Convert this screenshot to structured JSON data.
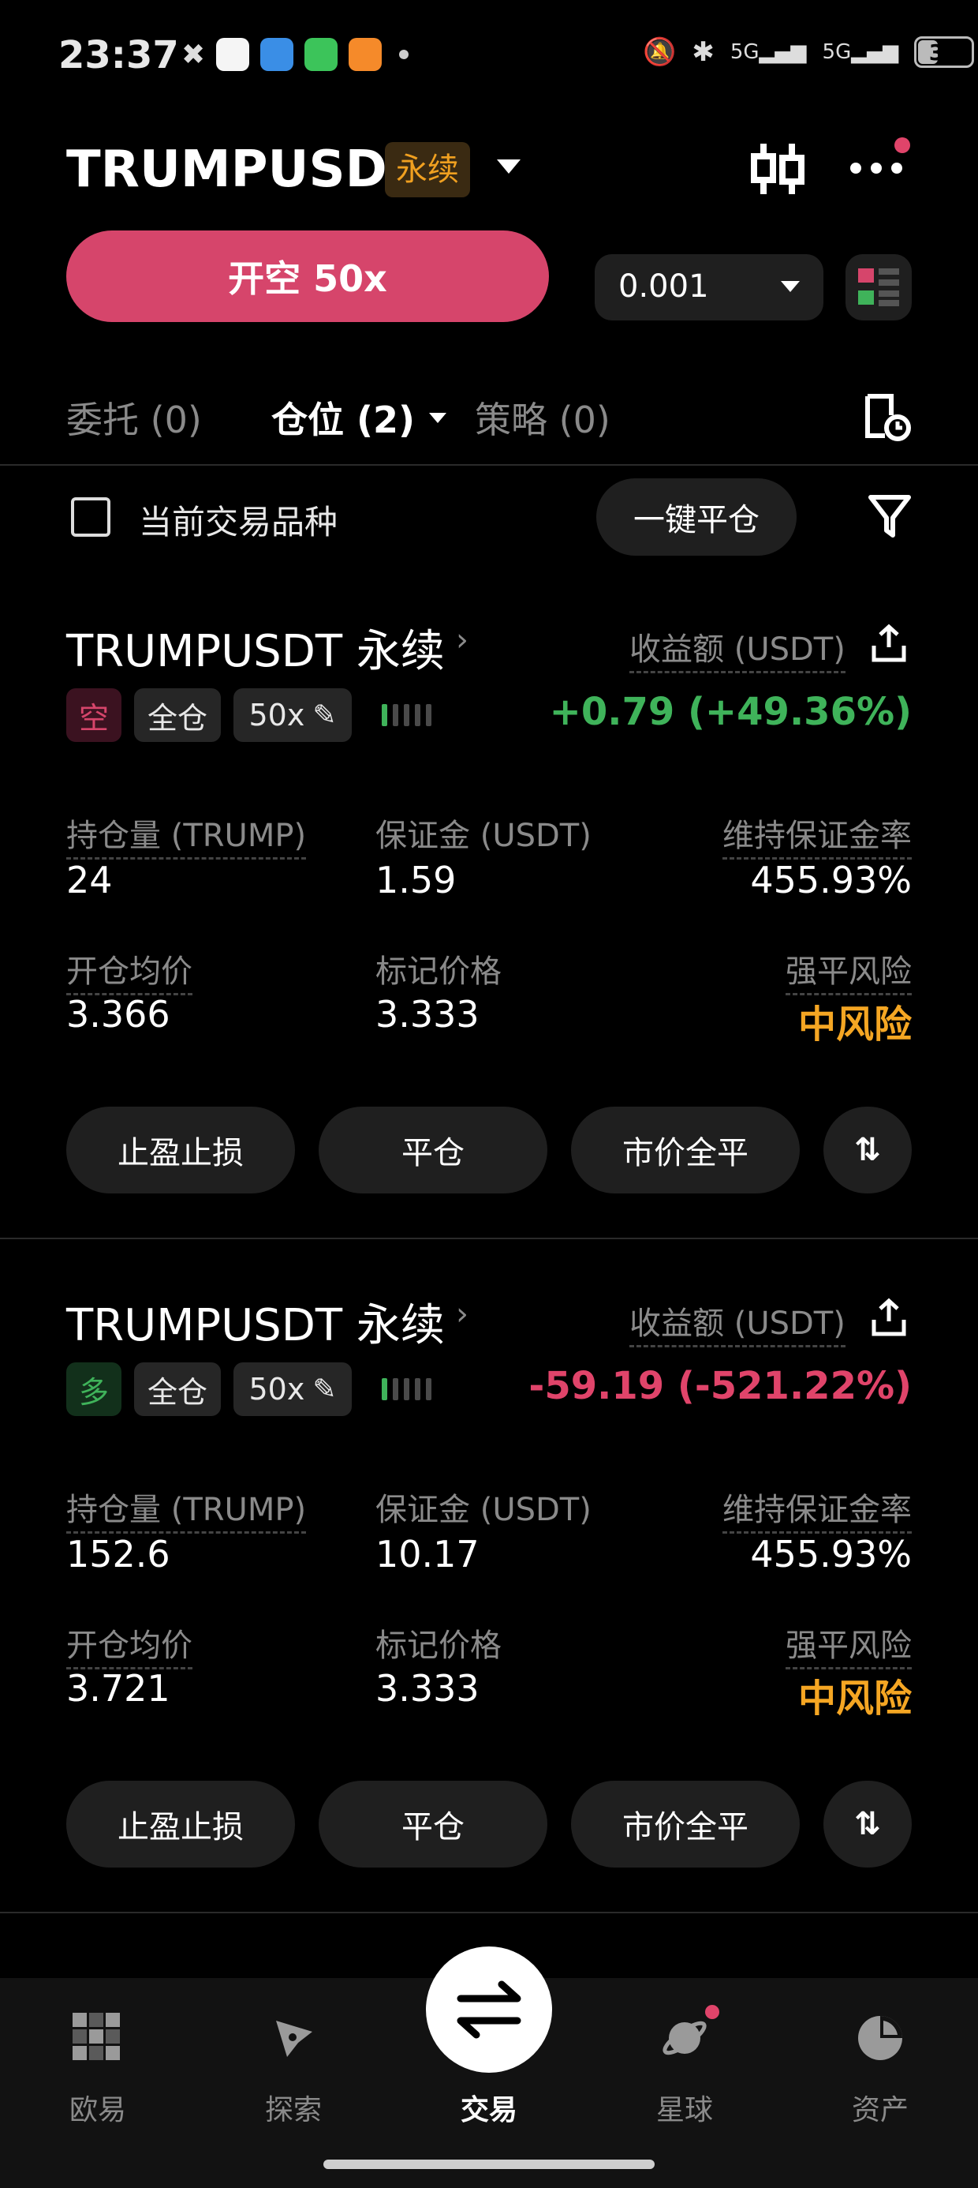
{
  "status_bar": {
    "time": "23:37",
    "battery": "36"
  },
  "header": {
    "symbol": "TRUMPUSDT",
    "badge": "永续"
  },
  "order": {
    "open_button": "开空 50x",
    "quantity": "0.001"
  },
  "tabs": [
    {
      "label": "委托 (0)"
    },
    {
      "label": "仓位 (2)"
    },
    {
      "label": "策略 (0)"
    }
  ],
  "filter": {
    "checkbox_label": "当前交易品种",
    "close_all": "一键平仓"
  },
  "positions": [
    {
      "title": "TRUMPUSDT 永续",
      "pnl_label": "收益额 (USDT)",
      "side": "空",
      "mode": "全仓",
      "leverage": "50x",
      "pnl": "+0.79 (+49.36%)",
      "size_label": "持仓量 (TRUMP)",
      "size": "24",
      "margin_label": "保证金 (USDT)",
      "margin": "1.59",
      "mmr_label": "维持保证金率",
      "mmr": "455.93%",
      "entry_label": "开仓均价",
      "entry": "3.366",
      "mark_label": "标记价格",
      "mark": "3.333",
      "risk_label": "强平风险",
      "risk": "中风险",
      "actions": [
        "止盈止损",
        "平仓",
        "市价全平"
      ]
    },
    {
      "title": "TRUMPUSDT 永续",
      "pnl_label": "收益额 (USDT)",
      "side": "多",
      "mode": "全仓",
      "leverage": "50x",
      "pnl": "-59.19 (-521.22%)",
      "size_label": "持仓量 (TRUMP)",
      "size": "152.6",
      "margin_label": "保证金 (USDT)",
      "margin": "10.17",
      "mmr_label": "维持保证金率",
      "mmr": "455.93%",
      "entry_label": "开仓均价",
      "entry": "3.721",
      "mark_label": "标记价格",
      "mark": "3.333",
      "risk_label": "强平风险",
      "risk": "中风险",
      "actions": [
        "止盈止损",
        "平仓",
        "市价全平"
      ]
    }
  ],
  "bottom_nav": [
    {
      "label": "欧易",
      "icon": "okx-logo-icon"
    },
    {
      "label": "探索",
      "icon": "compass-icon"
    },
    {
      "label": "交易",
      "icon": "swap-arrows-icon"
    },
    {
      "label": "星球",
      "icon": "planet-icon"
    },
    {
      "label": "资产",
      "icon": "pie-chart-icon"
    }
  ],
  "colors": {
    "short": "#d6456b",
    "profit": "#3fb35a",
    "loss": "#e0446a",
    "risk": "#f5a623",
    "badge": "#f0a020"
  }
}
